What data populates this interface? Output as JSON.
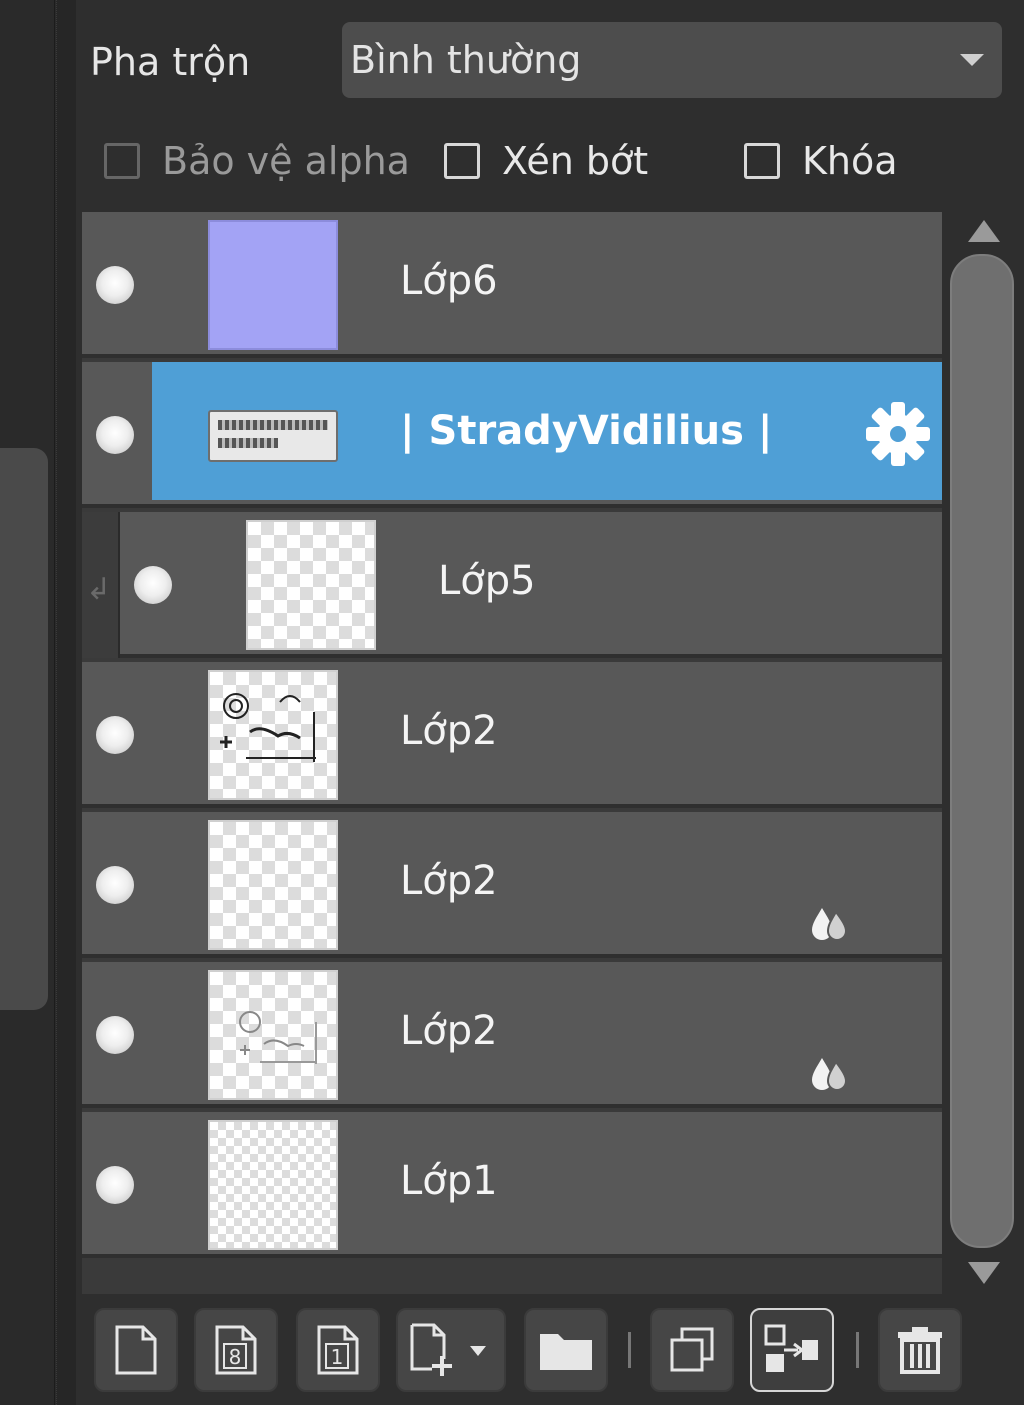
{
  "blend": {
    "label": "Pha trộn",
    "value": "Bình thường"
  },
  "options": {
    "protect_alpha": {
      "label": "Bảo vệ alpha",
      "checked": false,
      "enabled": false
    },
    "clip": {
      "label": "Xén bớt",
      "checked": false,
      "enabled": true
    },
    "lock": {
      "label": "Khóa",
      "checked": false,
      "enabled": true
    }
  },
  "layers": [
    {
      "name": "Lớp6",
      "thumb": "solid-color",
      "visible": true,
      "selected": false
    },
    {
      "name": "| StradyVidilius |",
      "thumb": "text",
      "visible": true,
      "selected": true,
      "settings_icon": "gear-icon"
    },
    {
      "name": "Lớp5",
      "thumb": "transparent",
      "visible": true,
      "selected": false,
      "clipped": true
    },
    {
      "name": "Lớp2",
      "thumb": "sketch",
      "visible": true,
      "selected": false
    },
    {
      "name": "Lớp2",
      "thumb": "transparent",
      "visible": true,
      "selected": false,
      "badge": "opacity-drops-icon"
    },
    {
      "name": "Lớp2",
      "thumb": "sketch-faded",
      "visible": true,
      "selected": false,
      "badge": "opacity-drops-icon"
    },
    {
      "name": "Lớp1",
      "thumb": "pattern",
      "visible": true,
      "selected": false
    }
  ],
  "toolbar": {
    "buttons": [
      "new-layer-icon",
      "new-8bit-layer-icon",
      "new-1bit-layer-icon",
      "add-layer-menu-icon",
      "new-folder-icon",
      "duplicate-layer-icon",
      "merge-down-icon",
      "delete-layer-icon"
    ]
  },
  "colors": {
    "selected_row": "#4f9fd6",
    "row": "#585858",
    "solid_thumb": "#a3a3f5"
  }
}
